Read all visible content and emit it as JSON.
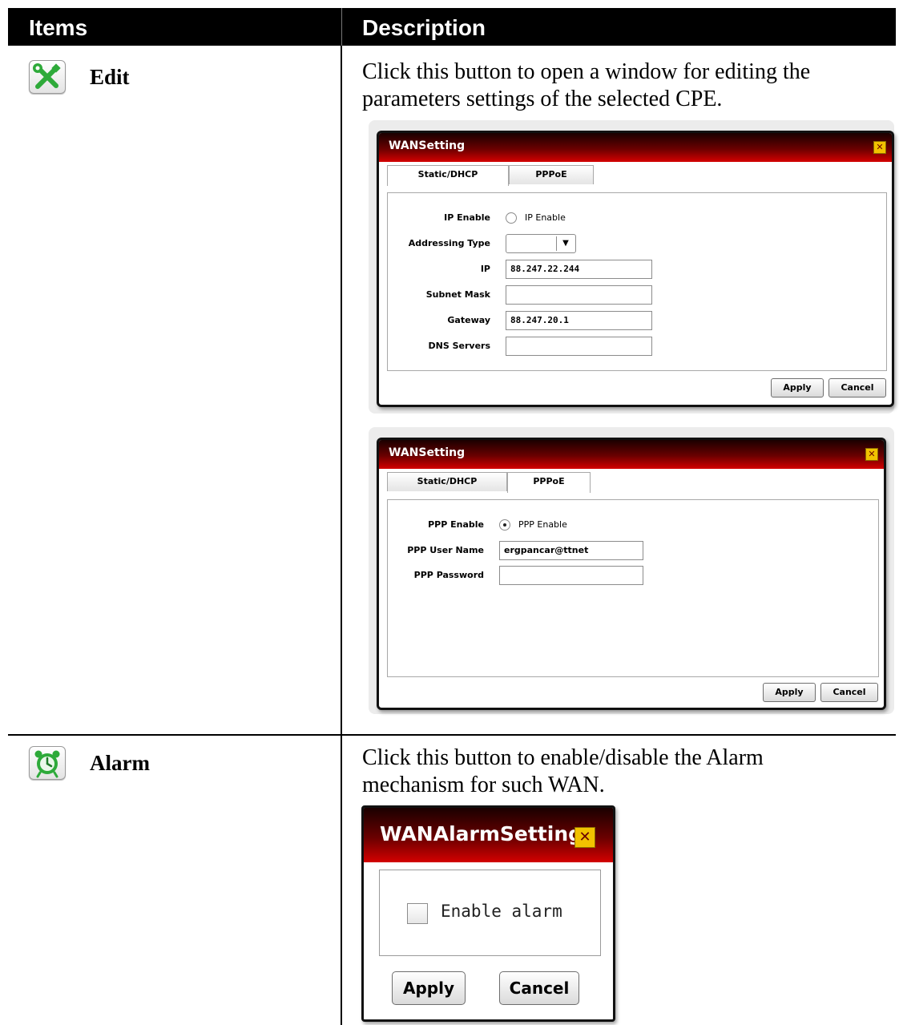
{
  "header": {
    "items": "Items",
    "description": "Description"
  },
  "rows": [
    {
      "label": "Edit",
      "icon": "wrench-screwdriver-icon",
      "description": "Click this button to open a window for editing the parameters settings of the selected CPE.",
      "dialog_static": {
        "title": "WANSetting",
        "tabs": [
          "Static/DHCP",
          "PPPoE"
        ],
        "fields": {
          "ip_enable_label": "IP Enable",
          "ip_enable_option": "IP Enable",
          "addressing_type_label": "Addressing Type",
          "addressing_type_value": "",
          "ip_label": "IP",
          "ip_value": "88.247.22.244",
          "subnet_label": "Subnet Mask",
          "subnet_value": "",
          "gateway_label": "Gateway",
          "gateway_value": "88.247.20.1",
          "dns_label": "DNS Servers",
          "dns_value": ""
        },
        "apply": "Apply",
        "cancel": "Cancel"
      },
      "dialog_pppoe": {
        "title": "WANSetting",
        "tabs": [
          "Static/DHCP",
          "PPPoE"
        ],
        "fields": {
          "ppp_enable_label": "PPP Enable",
          "ppp_enable_option": "PPP Enable",
          "ppp_user_label": "PPP User Name",
          "ppp_user_value": "ergpancar@ttnet",
          "ppp_password_label": "PPP Password",
          "ppp_password_value": ""
        },
        "apply": "Apply",
        "cancel": "Cancel"
      }
    },
    {
      "label": "Alarm",
      "icon": "alarm-clock-icon",
      "description": "Click this button to enable/disable the Alarm mechanism for such WAN.",
      "dialog_alarm": {
        "title": "WANAlarmSetting",
        "checkbox_label": "Enable alarm",
        "checked": false,
        "apply": "Apply",
        "cancel": "Cancel"
      }
    }
  ],
  "colors": {
    "header_bg": "#000000",
    "dialog_title_dark": "#1a0000",
    "dialog_title_red": "#d40000",
    "close_yellow": "#f2c200",
    "icon_green": "#2eaa3a"
  }
}
